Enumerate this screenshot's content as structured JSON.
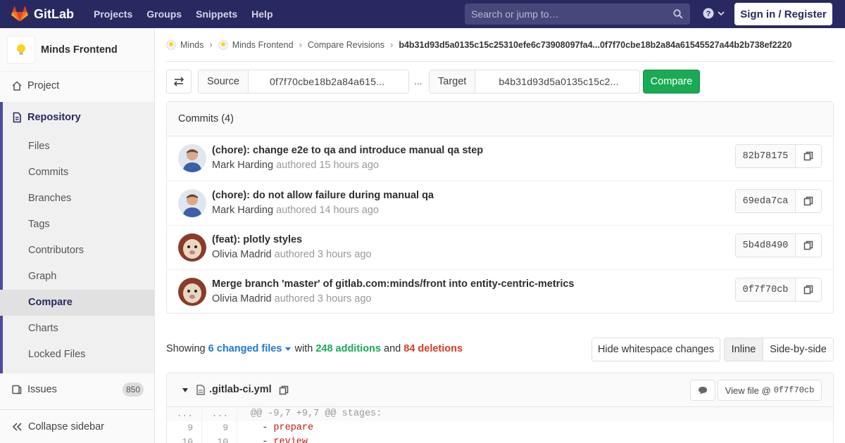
{
  "navbar": {
    "brand": "GitLab",
    "links": [
      "Projects",
      "Groups",
      "Snippets",
      "Help"
    ],
    "search_placeholder": "Search or jump to…",
    "signin_label": "Sign in / Register"
  },
  "sidebar": {
    "project_name": "Minds Frontend",
    "project_label": "Project",
    "repository_label": "Repository",
    "sub_items": [
      "Files",
      "Commits",
      "Branches",
      "Tags",
      "Contributors",
      "Graph",
      "Compare",
      "Charts",
      "Locked Files"
    ],
    "active_sub_item": "Compare",
    "issues_label": "Issues",
    "issues_count": "850",
    "collapse_label": "Collapse sidebar"
  },
  "breadcrumb": {
    "items": [
      "Minds",
      "Minds Frontend",
      "Compare Revisions"
    ],
    "current": "b4b31d93d5a0135c15c25310efe6c73908097fa4...0f7f70cbe18b2a84a61545527a44b2b738ef2220"
  },
  "compare": {
    "source_label": "Source",
    "source_value": "0f7f70cbe18b2a84a615...",
    "separator": "...",
    "target_label": "Target",
    "target_value": "b4b31d93d5a0135c15c2...",
    "compare_label": "Compare"
  },
  "commits": {
    "header": "Commits (4)",
    "items": [
      {
        "title": "(chore): change e2e to qa and introduce manual qa step",
        "author": "Mark Harding",
        "meta": "authored 15 hours ago",
        "sha": "82b78175"
      },
      {
        "title": "(chore): do not allow failure during manual qa",
        "author": "Mark Harding",
        "meta": "authored 14 hours ago",
        "sha": "69eda7ca"
      },
      {
        "title": "(feat): plotly styles",
        "author": "Olivia Madrid",
        "meta": "authored 3 hours ago",
        "sha": "5b4d8490"
      },
      {
        "title": "Merge branch 'master' of gitlab.com:minds/front into entity-centric-metrics",
        "author": "Olivia Madrid",
        "meta": "authored 3 hours ago",
        "sha": "0f7f70cb"
      }
    ]
  },
  "summary": {
    "showing": "Showing",
    "files": "6 changed files",
    "with": "with",
    "additions": "248 additions",
    "and": "and",
    "deletions": "84 deletions"
  },
  "toolbar": {
    "whitespace_label": "Hide whitespace changes",
    "inline_label": "Inline",
    "side_by_side_label": "Side-by-side"
  },
  "file": {
    "name": ".gitlab-ci.yml",
    "view_file_label": "View file @",
    "view_file_sha": "0f7f70cb",
    "lines": [
      {
        "old": "...",
        "new": "...",
        "text": "@@ -9,7 +9,7 @@ stages:"
      },
      {
        "old": "9",
        "new": "9",
        "prefix": "  - ",
        "value": "prepare"
      },
      {
        "old": "10",
        "new": "10",
        "prefix": "  - ",
        "value": "review"
      }
    ]
  },
  "colors": {
    "navbar": "#292961",
    "accent": "#4b4ba3",
    "compare_button": "#1aaa55",
    "link": "#1f78d1",
    "deletions": "#db3b21"
  }
}
